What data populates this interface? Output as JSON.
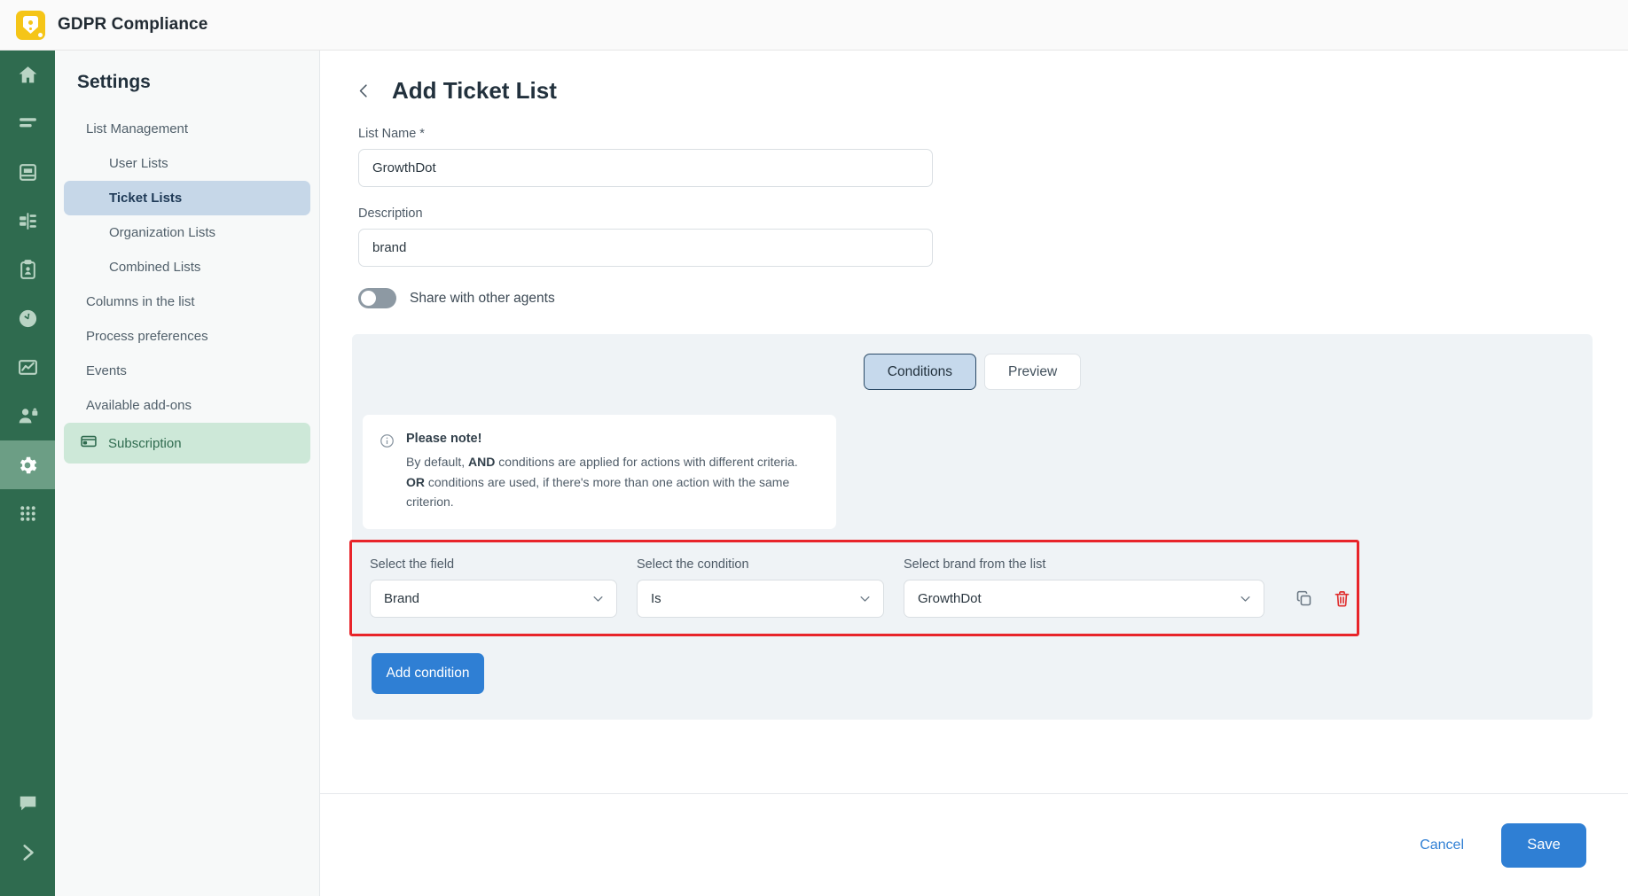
{
  "header": {
    "app_title": "GDPR Compliance",
    "logo_icon": "gdpr-shield-icon"
  },
  "rail": {
    "items": [
      {
        "icon": "home-icon",
        "active": false
      },
      {
        "icon": "list-icon",
        "active": false
      },
      {
        "icon": "database-icon",
        "active": false
      },
      {
        "icon": "reports-icon",
        "active": false
      },
      {
        "icon": "clipboard-user-icon",
        "active": false
      },
      {
        "icon": "clock-icon",
        "active": false
      },
      {
        "icon": "analytics-chart-icon",
        "active": false
      },
      {
        "icon": "user-lock-icon",
        "active": false
      },
      {
        "icon": "gear-icon",
        "active": true
      },
      {
        "icon": "apps-grid-icon",
        "active": false
      }
    ],
    "bottom_items": [
      {
        "icon": "chat-icon"
      },
      {
        "icon": "chevron-right-icon"
      }
    ]
  },
  "settings_nav": {
    "title": "Settings",
    "items": [
      {
        "label": "List Management",
        "level": "top",
        "state": "default"
      },
      {
        "label": "User Lists",
        "level": "sub",
        "state": "default"
      },
      {
        "label": "Ticket Lists",
        "level": "sub",
        "state": "selected"
      },
      {
        "label": "Organization Lists",
        "level": "sub",
        "state": "default"
      },
      {
        "label": "Combined Lists",
        "level": "sub",
        "state": "default"
      },
      {
        "label": "Columns in the list",
        "level": "top",
        "state": "default"
      },
      {
        "label": "Process preferences",
        "level": "top",
        "state": "default"
      },
      {
        "label": "Events",
        "level": "top",
        "state": "default"
      },
      {
        "label": "Available add-ons",
        "level": "top",
        "state": "default"
      }
    ],
    "subscription": {
      "label": "Subscription",
      "icon": "credit-card-icon"
    }
  },
  "main": {
    "back_icon": "chevron-left-icon",
    "title": "Add Ticket List",
    "list_name": {
      "label": "List Name *",
      "value": "GrowthDot"
    },
    "description": {
      "label": "Description",
      "value": "brand"
    },
    "share_toggle": {
      "label": "Share with other agents",
      "state": "off"
    },
    "tabs": [
      {
        "label": "Conditions",
        "active": true
      },
      {
        "label": "Preview",
        "active": false
      }
    ],
    "note": {
      "icon": "info-icon",
      "title": "Please note!",
      "line1_prefix": "By default, ",
      "line1_bold": "AND",
      "line1_suffix": " conditions are applied for actions with different criteria.",
      "line2_bold": "OR",
      "line2_suffix": " conditions are used, if there's more than one action with the same criterion."
    },
    "condition_row": {
      "field": {
        "label": "Select the field",
        "value": "Brand"
      },
      "condition": {
        "label": "Select the condition",
        "value": "Is"
      },
      "brand": {
        "label": "Select brand from the list",
        "value": "GrowthDot"
      },
      "copy_icon": "copy-icon",
      "delete_icon": "trash-icon",
      "highlight_color": "#e8242a"
    },
    "add_condition_label": "Add condition"
  },
  "footer": {
    "cancel_label": "Cancel",
    "save_label": "Save"
  },
  "colors": {
    "rail_green": "#2f6b4f",
    "accent_blue": "#2f7fd4",
    "selected_nav": "#c6d7e8",
    "subscription_green": "#cde8d8",
    "logo_yellow": "#f5c518"
  }
}
